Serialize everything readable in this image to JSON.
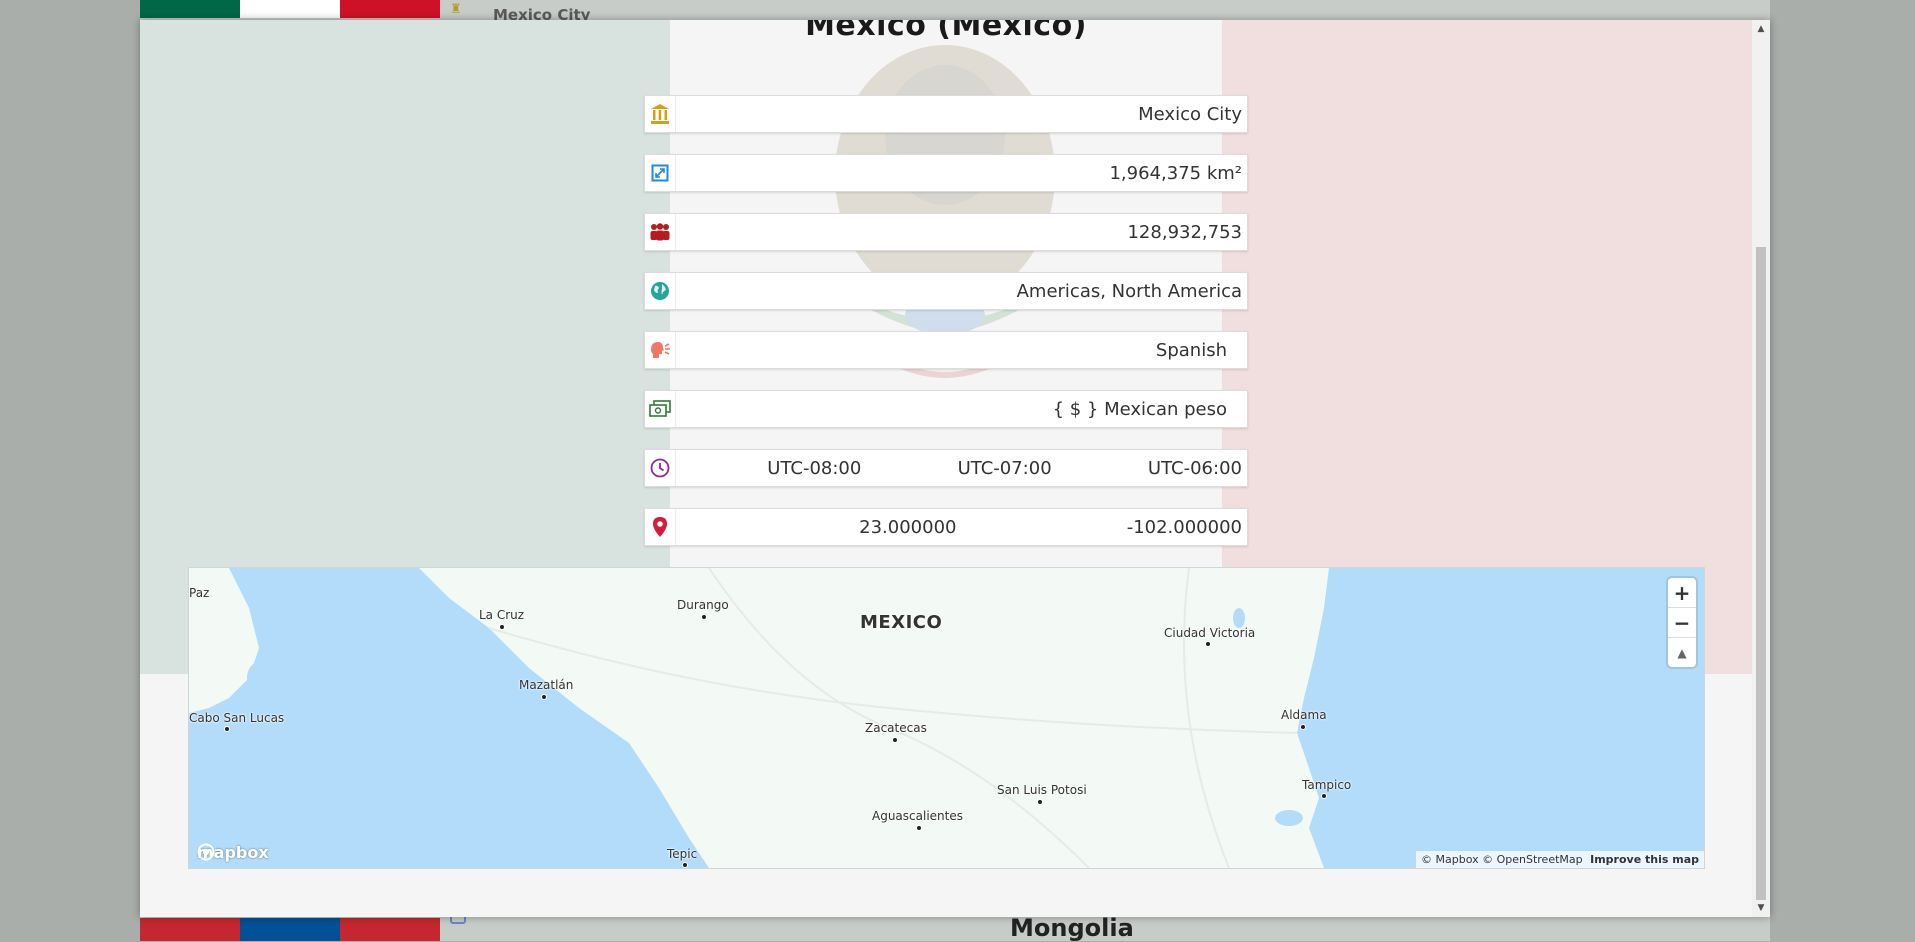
{
  "background": {
    "top_caption": "Mexico City",
    "next_country": "Mongolia",
    "mexico_flag": [
      "#006847",
      "#ffffff",
      "#ce1126"
    ],
    "mongolia_flag": [
      "#c4272f",
      "#015197",
      "#c4272f"
    ]
  },
  "modal": {
    "title": "Mexico (Mexico)",
    "rows": {
      "capital": {
        "icon": "capital-building-icon",
        "value": "Mexico City"
      },
      "area": {
        "icon": "area-expand-icon",
        "value": "1,964,375 km²"
      },
      "population": {
        "icon": "people-icon",
        "value": "128,932,753"
      },
      "region": {
        "icon": "globe-icon",
        "value": "Americas, North America"
      },
      "language": {
        "icon": "speaking-head-icon",
        "value": "Spanish"
      },
      "currency": {
        "icon": "money-icon",
        "value": "{ $ } Mexican peso"
      },
      "timezones": {
        "icon": "clock-icon",
        "values": [
          "UTC-08:00",
          "UTC-07:00",
          "UTC-06:00"
        ]
      },
      "coordinates": {
        "icon": "map-pin-icon",
        "lat": "23.000000",
        "lng": "-102.000000"
      }
    },
    "icon_colors": {
      "capital": "#d4a017",
      "area": "#1e88e5",
      "population": "#b71c1c",
      "region": "#26a69a",
      "language": "#ef7766",
      "currency": "#2e7d32",
      "timezones": "#8e24aa",
      "coordinates": "#d81b3a"
    },
    "map": {
      "country_label": "MEXICO",
      "cities": {
        "paz": "Paz",
        "la_cruz": "La Cruz",
        "durango": "Durango",
        "mazatlan": "Mazatlán",
        "cabo": "Cabo San Lucas",
        "zacatecas": "Zacatecas",
        "ciudad_victoria": "Ciudad Victoria",
        "aldama": "Aldama",
        "tampico": "Tampico",
        "san_luis_potosi": "San Luis Potosi",
        "aguascalientes": "Aguascalientes",
        "tepic": "Tepic"
      },
      "zoom_in": "+",
      "zoom_out": "−",
      "compass": "▲",
      "logo": "mapbox",
      "attribution": "© Mapbox © OpenStreetMap",
      "improve": "Improve this map"
    }
  }
}
